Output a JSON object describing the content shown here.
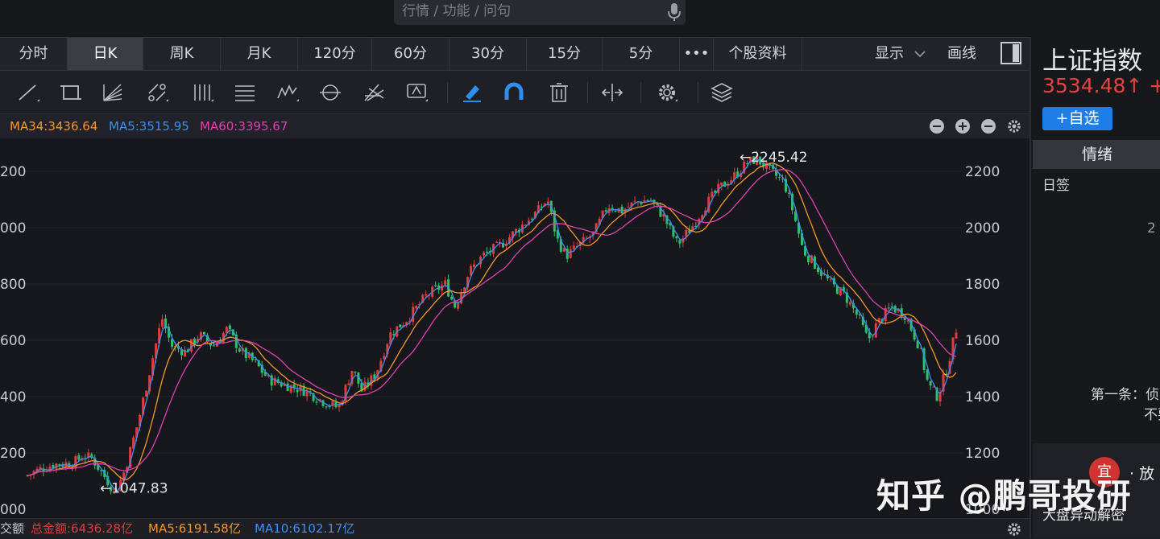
{
  "search": {
    "placeholder": "行情 / 功能 / 问句"
  },
  "tabs": [
    "分时",
    "日K",
    "周K",
    "月K",
    "120分",
    "60分",
    "30分",
    "15分",
    "5分",
    "•••",
    "个股资料"
  ],
  "active_tab": "日K",
  "tab_right": {
    "display": "显示",
    "draw": "画线"
  },
  "ma_row": {
    "ma34": "MA34:3436.64",
    "ma5": "MA5:3515.95",
    "ma60": "MA60:3395.67"
  },
  "bottom_row": {
    "label": "交额",
    "total": "总金额:6436.28亿",
    "ma5": "MA5:6191.58亿",
    "ma10": "MA10:6102.17亿"
  },
  "side": {
    "title": "上证指数",
    "price": "3534.48↑ +",
    "add_button": "+自选",
    "tab": "情绪",
    "label": "日签",
    "num": "2",
    "news1": "第一条：侦",
    "news2": "不要",
    "badge": "宜",
    "fang": "· 放",
    "bottom": "大盘异动解密"
  },
  "watermark": "知乎 @鹏哥投研",
  "colors": {
    "up": "#e23b3b",
    "down": "#2ec06a",
    "ma34": "#f5962c",
    "ma5": "#3b8ff2",
    "ma60": "#e040b0",
    "accent_blue": "#1f7de7"
  },
  "chart_data": {
    "type": "candlestick",
    "y_ticks_left": [
      "200",
      "000",
      "800",
      "600",
      "400",
      "200",
      "000"
    ],
    "y_ticks_right": [
      "2200",
      "2000",
      "1800",
      "1600",
      "1400",
      "1200",
      "1000"
    ],
    "ylim": [
      1000,
      2300
    ],
    "annotations": [
      {
        "text": "←2245.42",
        "value": 2245.42
      },
      {
        "text": "←1047.83",
        "value": 1047.83
      }
    ],
    "trend": [
      [
        0,
        1120
      ],
      [
        0.015,
        1145
      ],
      [
        0.03,
        1160
      ],
      [
        0.05,
        1165
      ],
      [
        0.06,
        1190
      ],
      [
        0.07,
        1180
      ],
      [
        0.08,
        1130
      ],
      [
        0.095,
        1060
      ],
      [
        0.105,
        1140
      ],
      [
        0.12,
        1320
      ],
      [
        0.135,
        1540
      ],
      [
        0.145,
        1680
      ],
      [
        0.155,
        1580
      ],
      [
        0.17,
        1560
      ],
      [
        0.185,
        1620
      ],
      [
        0.2,
        1580
      ],
      [
        0.215,
        1640
      ],
      [
        0.23,
        1560
      ],
      [
        0.245,
        1520
      ],
      [
        0.26,
        1460
      ],
      [
        0.28,
        1440
      ],
      [
        0.3,
        1420
      ],
      [
        0.32,
        1380
      ],
      [
        0.335,
        1360
      ],
      [
        0.35,
        1500
      ],
      [
        0.36,
        1420
      ],
      [
        0.375,
        1480
      ],
      [
        0.39,
        1620
      ],
      [
        0.41,
        1680
      ],
      [
        0.43,
        1760
      ],
      [
        0.45,
        1800
      ],
      [
        0.46,
        1720
      ],
      [
        0.475,
        1840
      ],
      [
        0.49,
        1900
      ],
      [
        0.51,
        1940
      ],
      [
        0.53,
        2000
      ],
      [
        0.55,
        2060
      ],
      [
        0.56,
        2100
      ],
      [
        0.57,
        1960
      ],
      [
        0.58,
        1900
      ],
      [
        0.595,
        1940
      ],
      [
        0.61,
        1980
      ],
      [
        0.625,
        2080
      ],
      [
        0.64,
        2060
      ],
      [
        0.655,
        2090
      ],
      [
        0.67,
        2100
      ],
      [
        0.685,
        2040
      ],
      [
        0.7,
        1940
      ],
      [
        0.715,
        2000
      ],
      [
        0.73,
        2080
      ],
      [
        0.745,
        2140
      ],
      [
        0.76,
        2180
      ],
      [
        0.775,
        2230
      ],
      [
        0.785,
        2245
      ],
      [
        0.8,
        2200
      ],
      [
        0.815,
        2160
      ],
      [
        0.825,
        2050
      ],
      [
        0.835,
        1920
      ],
      [
        0.85,
        1860
      ],
      [
        0.865,
        1800
      ],
      [
        0.88,
        1760
      ],
      [
        0.895,
        1680
      ],
      [
        0.905,
        1600
      ],
      [
        0.915,
        1660
      ],
      [
        0.93,
        1720
      ],
      [
        0.945,
        1690
      ],
      [
        0.96,
        1580
      ],
      [
        0.97,
        1440
      ],
      [
        0.98,
        1400
      ],
      [
        0.99,
        1500
      ],
      [
        1.0,
        1640
      ]
    ]
  }
}
